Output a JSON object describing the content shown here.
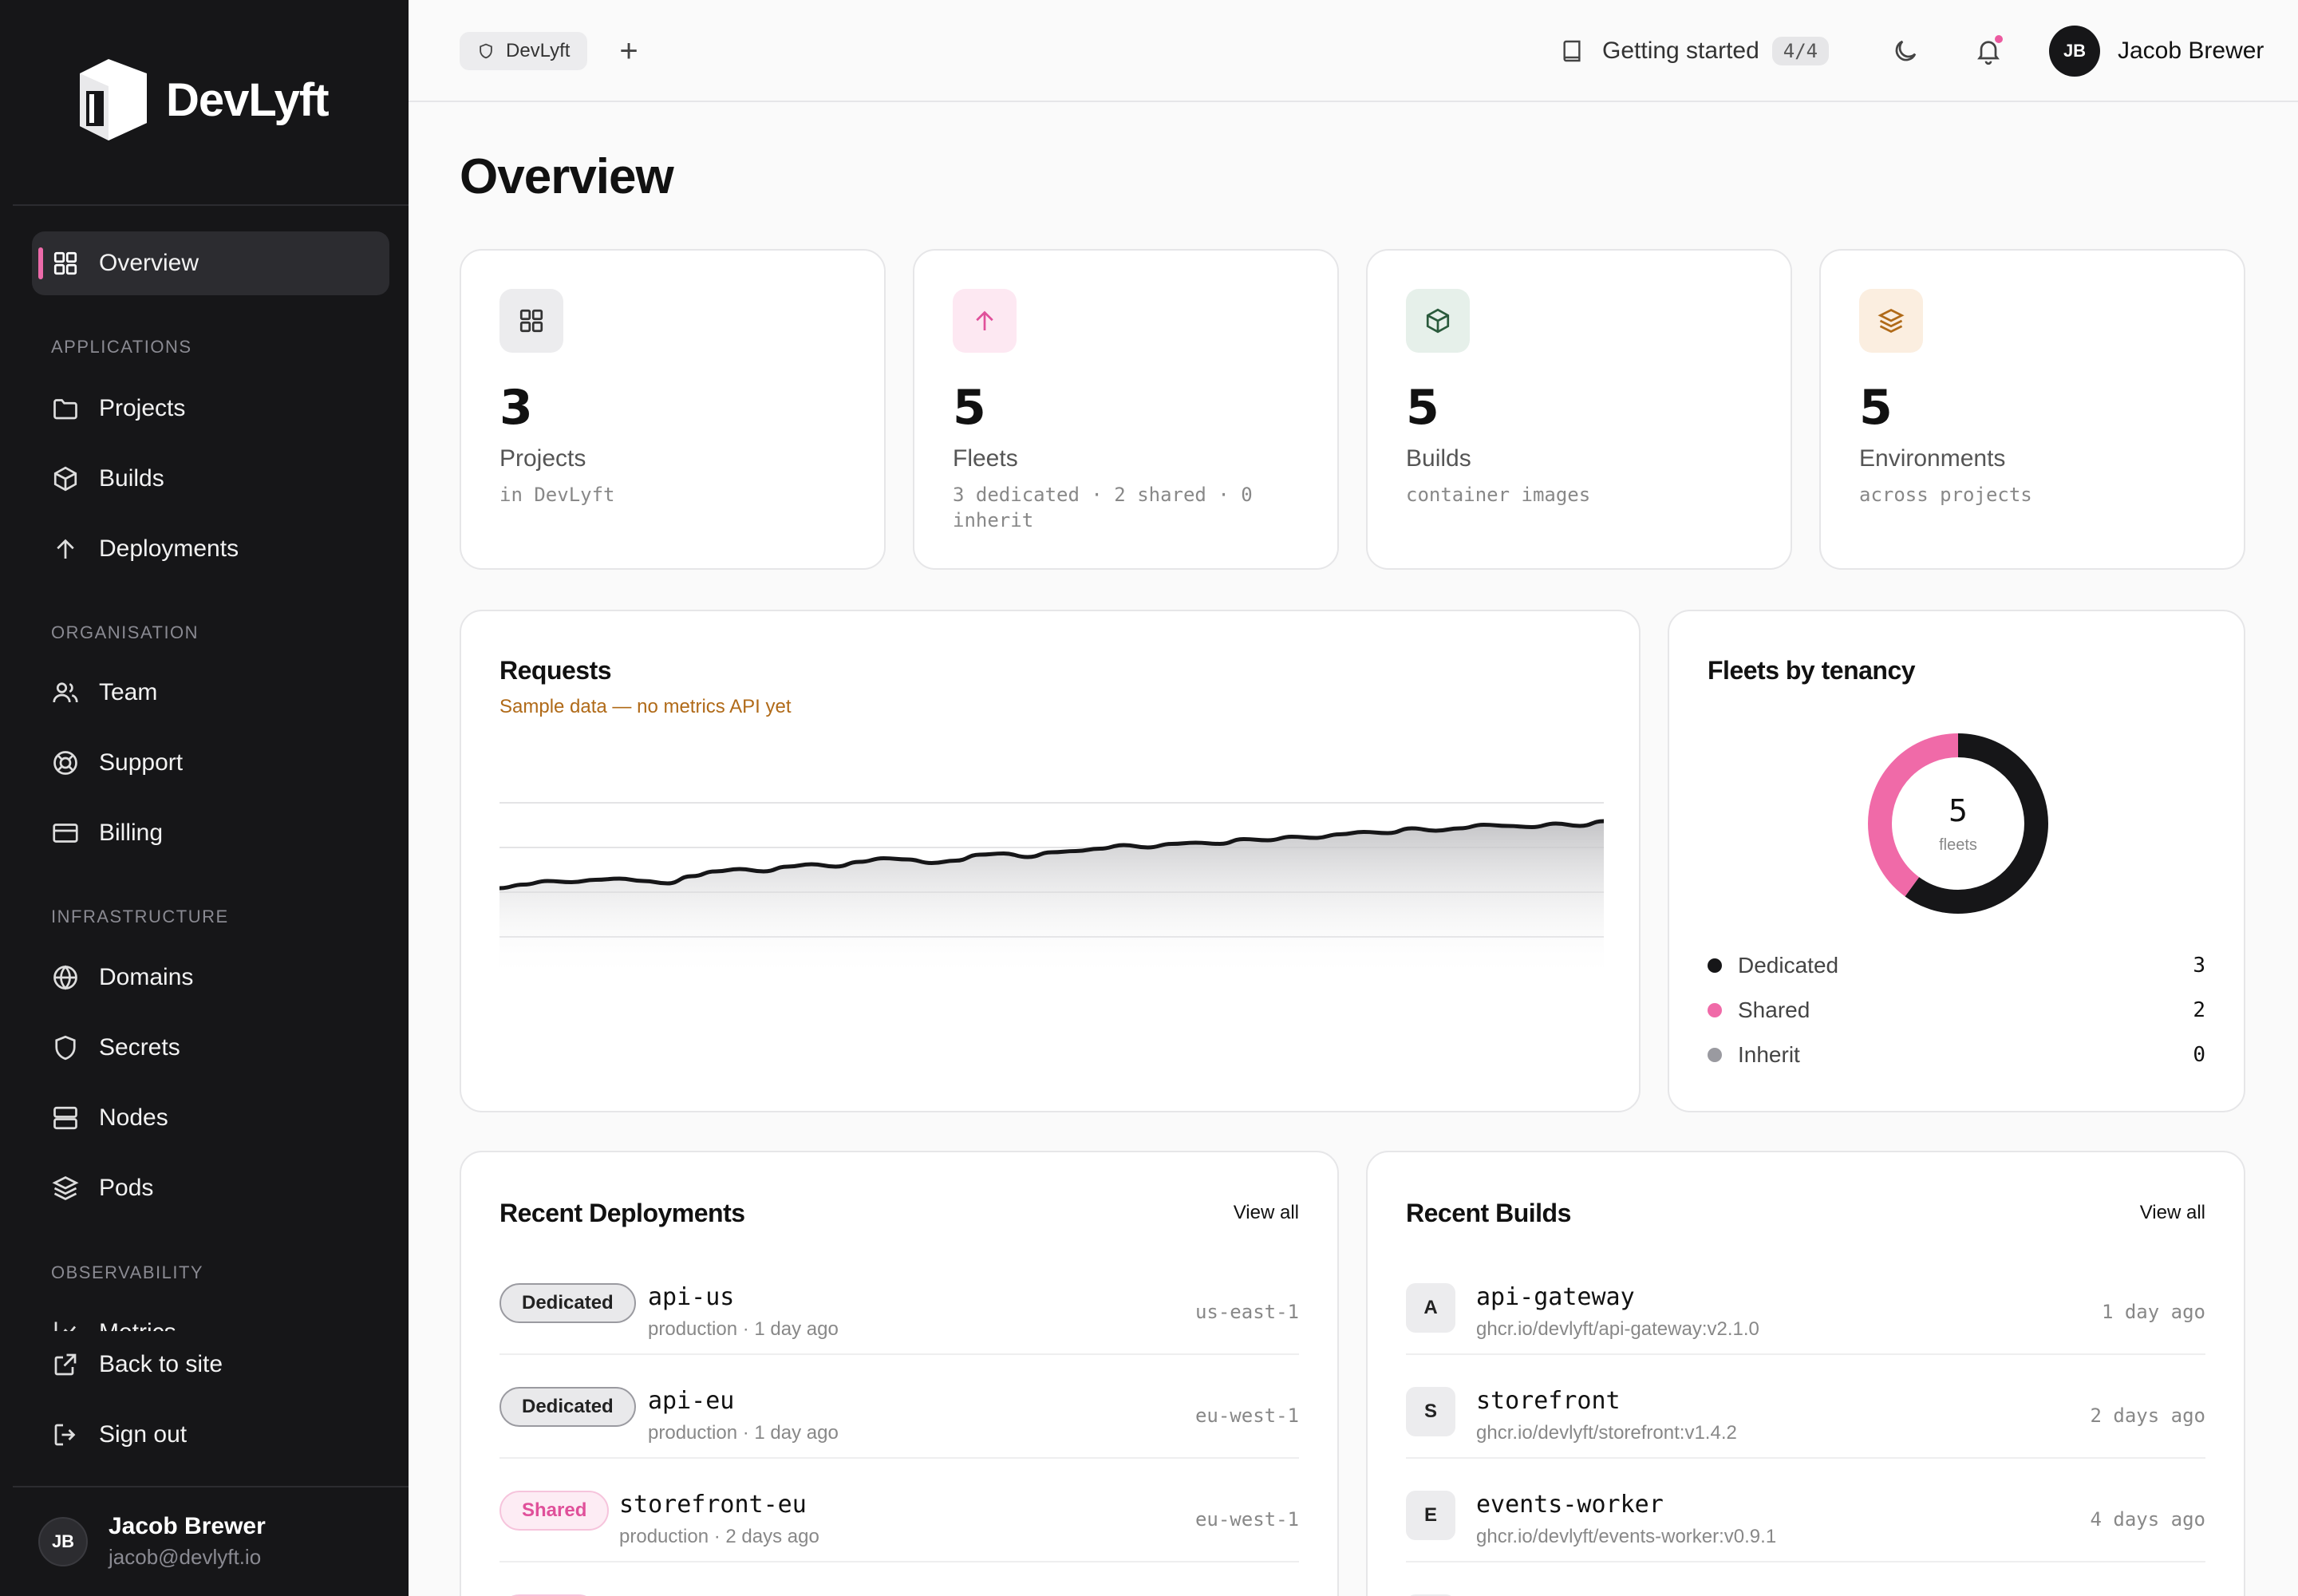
{
  "brand": {
    "name": "DevLyft"
  },
  "sidebar": {
    "active": {
      "label": "Overview",
      "icon": "grid-icon"
    },
    "sections": [
      {
        "title": "APPLICATIONS",
        "items": [
          {
            "label": "Projects",
            "icon": "folder-icon"
          },
          {
            "label": "Builds",
            "icon": "cube-icon"
          },
          {
            "label": "Deployments",
            "icon": "arrow-up-icon"
          }
        ]
      },
      {
        "title": "ORGANISATION",
        "items": [
          {
            "label": "Team",
            "icon": "users-icon"
          },
          {
            "label": "Support",
            "icon": "lifebuoy-icon"
          },
          {
            "label": "Billing",
            "icon": "credit-card-icon"
          }
        ]
      },
      {
        "title": "INFRASTRUCTURE",
        "items": [
          {
            "label": "Domains",
            "icon": "globe-icon"
          },
          {
            "label": "Secrets",
            "icon": "shield-icon"
          },
          {
            "label": "Nodes",
            "icon": "server-icon"
          },
          {
            "label": "Pods",
            "icon": "layers-icon"
          }
        ]
      },
      {
        "title": "OBSERVABILITY",
        "items": [
          {
            "label": "Metrics",
            "icon": "chart-icon"
          }
        ]
      }
    ],
    "footer_links": [
      {
        "label": "Back to site",
        "icon": "external-link-icon"
      },
      {
        "label": "Sign out",
        "icon": "sign-out-icon"
      }
    ],
    "user": {
      "initials": "JB",
      "name": "Jacob Brewer",
      "email": "jacob@devlyft.io"
    }
  },
  "topbar": {
    "workspace": "DevLyft",
    "add_label": "+",
    "getting_started": {
      "label": "Getting started",
      "badge": "4/4"
    },
    "user": {
      "initials": "JB",
      "name": "Jacob Brewer"
    }
  },
  "page": {
    "title": "Overview"
  },
  "stats": [
    {
      "value": "3",
      "label": "Projects",
      "sub": "in DevLyft",
      "icon": "grid-icon",
      "bg": "#ececee",
      "fg": "#333333"
    },
    {
      "value": "5",
      "label": "Fleets",
      "sub": "3 dedicated · 2 shared · 0 inherit",
      "icon": "arrow-up-icon",
      "bg": "#fde8f2",
      "fg": "#e0509a"
    },
    {
      "value": "5",
      "label": "Builds",
      "sub": "container images",
      "icon": "cube-icon",
      "bg": "#e6f0ea",
      "fg": "#2a5a3c"
    },
    {
      "value": "5",
      "label": "Environments",
      "sub": "across projects",
      "icon": "layers-icon",
      "bg": "#fbeee0",
      "fg": "#b06a18"
    }
  ],
  "requests": {
    "title": "Requests",
    "note": "Sample data — no metrics API yet"
  },
  "chart_data": {
    "type": "area",
    "title": "Requests",
    "values": [
      0.42,
      0.45,
      0.48,
      0.47,
      0.49,
      0.5,
      0.48,
      0.46,
      0.52,
      0.56,
      0.58,
      0.56,
      0.6,
      0.62,
      0.6,
      0.64,
      0.67,
      0.66,
      0.63,
      0.65,
      0.7,
      0.71,
      0.68,
      0.72,
      0.73,
      0.75,
      0.78,
      0.76,
      0.79,
      0.8,
      0.79,
      0.83,
      0.82,
      0.85,
      0.84,
      0.87,
      0.89,
      0.88,
      0.92,
      0.9,
      0.92,
      0.95,
      0.94,
      0.93,
      0.96,
      0.94,
      0.98
    ]
  },
  "tenancy": {
    "title": "Fleets by tenancy",
    "total": "5",
    "total_label": "fleets",
    "items": [
      {
        "label": "Dedicated",
        "value": 3,
        "value_text": "3",
        "color": "#161618"
      },
      {
        "label": "Shared",
        "value": 2,
        "value_text": "2",
        "color": "#f06aa8"
      },
      {
        "label": "Inherit",
        "value": 0,
        "value_text": "0",
        "color": "#9a9aa0"
      }
    ]
  },
  "deployments": {
    "title": "Recent Deployments",
    "view_all": "View all",
    "rows": [
      {
        "badge": "Dedicated",
        "name": "api-us",
        "sub": "production · 1 day ago",
        "region": "us-east-1"
      },
      {
        "badge": "Dedicated",
        "name": "api-eu",
        "sub": "production · 1 day ago",
        "region": "eu-west-1"
      },
      {
        "badge": "Shared",
        "name": "storefront-eu",
        "sub": "production · 2 days ago",
        "region": "eu-west-1"
      }
    ]
  },
  "builds": {
    "title": "Recent Builds",
    "view_all": "View all",
    "rows": [
      {
        "initial": "A",
        "name": "api-gateway",
        "sub": "ghcr.io/devlyft/api-gateway:v2.1.0",
        "time": "1 day ago"
      },
      {
        "initial": "S",
        "name": "storefront",
        "sub": "ghcr.io/devlyft/storefront:v1.4.2",
        "time": "2 days ago"
      },
      {
        "initial": "E",
        "name": "events-worker",
        "sub": "ghcr.io/devlyft/events-worker:v0.9.1",
        "time": "4 days ago"
      }
    ]
  }
}
